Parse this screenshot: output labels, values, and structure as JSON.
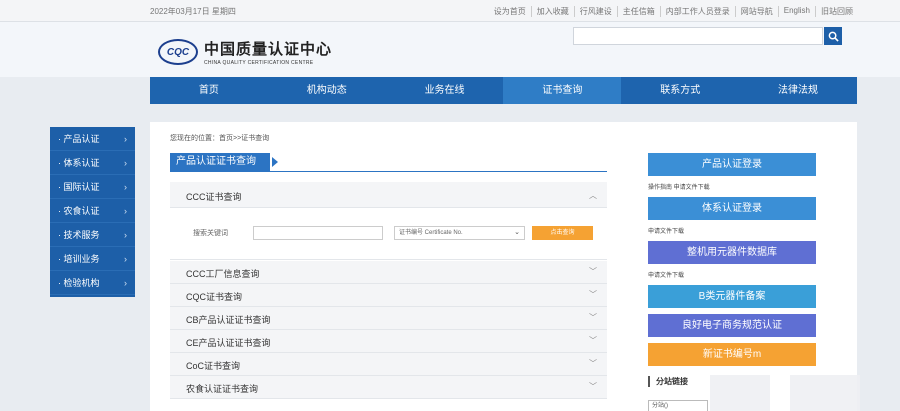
{
  "topbar": {
    "date": "2022年03月17日 星期四",
    "links": [
      "设为首页",
      "加入收藏",
      "行风建设",
      "主任信箱",
      "内部工作人员登录",
      "网站导航",
      "English",
      "旧站回顾"
    ]
  },
  "logo": {
    "mark": "CQC",
    "cn": "中国质量认证中心",
    "en": "CHINA QUALITY CERTIFICATION CENTRE"
  },
  "nav": {
    "items": [
      "首页",
      "机构动态",
      "业务在线",
      "证书查询",
      "联系方式",
      "法律法规"
    ]
  },
  "sidebar": {
    "items": [
      "产品认证",
      "体系认证",
      "国际认证",
      "农食认证",
      "技术服务",
      "培训业务",
      "检验机构"
    ]
  },
  "main": {
    "breadcrumb": "您现在的位置：首页>>证书查询",
    "section_title": "产品认证证书查询",
    "accordion": [
      "CCC证书查询",
      "CCC工厂信息查询",
      "CQC证书查询",
      "CB产品认证证书查询",
      "CE产品认证证书查询",
      "CoC证书查询",
      "农食认证证书查询"
    ],
    "panel": {
      "keyword_label": "搜索关键词",
      "select_value": "证书编号 Certificate No.",
      "query_button": "点击查询"
    }
  },
  "right": {
    "buttons": [
      "产品认证登录",
      "体系认证登录",
      "整机用元器件数据库",
      "B类元器件备案",
      "良好电子商务规范认证",
      "新证书编号m"
    ],
    "notes": [
      "操作指南   申请文件下载",
      "申请文件下载",
      "申请文件下载"
    ],
    "links_title": "分站链接",
    "links_select": "分站()"
  },
  "colors": {
    "nav": "#1e64ae",
    "button_blue": "#3b8fd6",
    "button_purple": "#5f6fd3",
    "button_orange": "#f5a233"
  }
}
